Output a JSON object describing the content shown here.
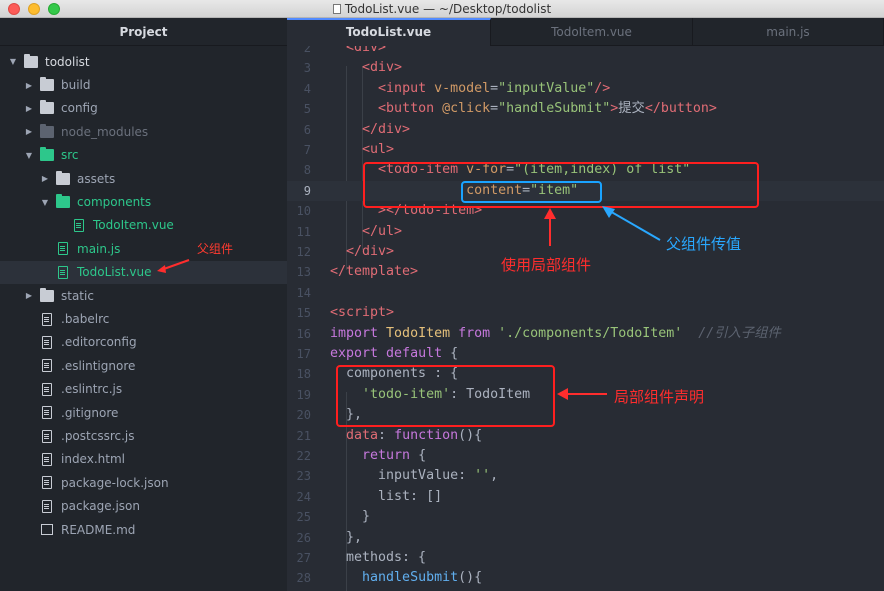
{
  "window": {
    "title": "TodoList.vue — ~/Desktop/todolist"
  },
  "sidebar": {
    "header": "Project",
    "items": [
      {
        "label": "todolist",
        "type": "folder",
        "arrow": "down",
        "depth": 0,
        "style": ""
      },
      {
        "label": "build",
        "type": "folder",
        "arrow": "right",
        "depth": 1,
        "style": ""
      },
      {
        "label": "config",
        "type": "folder",
        "arrow": "right",
        "depth": 1,
        "style": ""
      },
      {
        "label": "node_modules",
        "type": "folder",
        "arrow": "right",
        "depth": 1,
        "style": "dim"
      },
      {
        "label": "src",
        "type": "folder",
        "arrow": "down",
        "depth": 1,
        "style": "green"
      },
      {
        "label": "assets",
        "type": "folder",
        "arrow": "right",
        "depth": 2,
        "style": ""
      },
      {
        "label": "components",
        "type": "folder",
        "arrow": "down",
        "depth": 2,
        "style": "green"
      },
      {
        "label": "TodoItem.vue",
        "type": "file",
        "arrow": "",
        "depth": 3,
        "style": "green"
      },
      {
        "label": "main.js",
        "type": "file",
        "arrow": "",
        "depth": 2,
        "style": "green"
      },
      {
        "label": "TodoList.vue",
        "type": "file",
        "arrow": "",
        "depth": 2,
        "style": "green",
        "selected": true
      },
      {
        "label": "static",
        "type": "folder",
        "arrow": "right",
        "depth": 1,
        "style": ""
      },
      {
        "label": ".babelrc",
        "type": "file",
        "arrow": "",
        "depth": 1,
        "style": ""
      },
      {
        "label": ".editorconfig",
        "type": "file",
        "arrow": "",
        "depth": 1,
        "style": ""
      },
      {
        "label": ".eslintignore",
        "type": "file",
        "arrow": "",
        "depth": 1,
        "style": ""
      },
      {
        "label": ".eslintrc.js",
        "type": "file",
        "arrow": "",
        "depth": 1,
        "style": ""
      },
      {
        "label": ".gitignore",
        "type": "file",
        "arrow": "",
        "depth": 1,
        "style": ""
      },
      {
        "label": ".postcssrc.js",
        "type": "file",
        "arrow": "",
        "depth": 1,
        "style": ""
      },
      {
        "label": "index.html",
        "type": "file",
        "arrow": "",
        "depth": 1,
        "style": ""
      },
      {
        "label": "package-lock.json",
        "type": "file",
        "arrow": "",
        "depth": 1,
        "style": ""
      },
      {
        "label": "package.json",
        "type": "file",
        "arrow": "",
        "depth": 1,
        "style": ""
      },
      {
        "label": "README.md",
        "type": "book",
        "arrow": "",
        "depth": 1,
        "style": ""
      }
    ]
  },
  "tabs": [
    {
      "label": "TodoList.vue",
      "active": true
    },
    {
      "label": "TodoItem.vue",
      "active": false
    },
    {
      "label": "main.js",
      "active": false
    }
  ],
  "editor": {
    "current_line": 9,
    "lines": [
      {
        "n": "2",
        "t": [
          [
            "  ",
            "pun"
          ],
          [
            "<div>",
            "tag"
          ]
        ]
      },
      {
        "n": "3",
        "t": [
          [
            "    ",
            "pun"
          ],
          [
            "<div>",
            "tag"
          ]
        ]
      },
      {
        "n": "4",
        "t": [
          [
            "      ",
            "pun"
          ],
          [
            "<input ",
            "tag"
          ],
          [
            "v-model",
            "attr"
          ],
          [
            "=",
            "pun"
          ],
          [
            "\"inputValue\"",
            "str"
          ],
          [
            "/>",
            "tag"
          ]
        ]
      },
      {
        "n": "5",
        "t": [
          [
            "      ",
            "pun"
          ],
          [
            "<button ",
            "tag"
          ],
          [
            "@click",
            "attr"
          ],
          [
            "=",
            "pun"
          ],
          [
            "\"handleSubmit\"",
            "str"
          ],
          [
            ">",
            "tag"
          ],
          [
            "提交",
            "pun"
          ],
          [
            "</button>",
            "tag"
          ]
        ]
      },
      {
        "n": "6",
        "t": [
          [
            "    ",
            "pun"
          ],
          [
            "</div>",
            "tag"
          ]
        ]
      },
      {
        "n": "7",
        "t": [
          [
            "    ",
            "pun"
          ],
          [
            "<ul>",
            "tag"
          ]
        ]
      },
      {
        "n": "8",
        "t": [
          [
            "      ",
            "pun"
          ],
          [
            "<todo-item ",
            "tag"
          ],
          [
            "v-for",
            "attr"
          ],
          [
            "=",
            "pun"
          ],
          [
            "\"(item,index) of list\"",
            "str"
          ]
        ]
      },
      {
        "n": "9",
        "t": [
          [
            "                ",
            "pun"
          ],
          [
            ":content",
            "attr"
          ],
          [
            "=",
            "pun"
          ],
          [
            "\"item\"",
            "str"
          ]
        ]
      },
      {
        "n": "10",
        "t": [
          [
            "      ",
            "pun"
          ],
          [
            "></todo-item>",
            "tag"
          ]
        ]
      },
      {
        "n": "11",
        "t": [
          [
            "    ",
            "pun"
          ],
          [
            "</ul>",
            "tag"
          ]
        ]
      },
      {
        "n": "12",
        "t": [
          [
            "  ",
            "pun"
          ],
          [
            "</div>",
            "tag"
          ]
        ]
      },
      {
        "n": "13",
        "t": [
          [
            "</template>",
            "tag"
          ]
        ]
      },
      {
        "n": "14",
        "t": []
      },
      {
        "n": "15",
        "t": [
          [
            "<script>",
            "tag"
          ]
        ]
      },
      {
        "n": "16",
        "t": [
          [
            "import ",
            "kw"
          ],
          [
            "TodoItem ",
            "cls"
          ],
          [
            "from ",
            "kw"
          ],
          [
            "'./components/TodoItem'",
            "str"
          ],
          [
            "  //引入子组件",
            "cmt"
          ]
        ]
      },
      {
        "n": "17",
        "t": [
          [
            "export ",
            "kw"
          ],
          [
            "default ",
            "kw"
          ],
          [
            "{",
            "pun"
          ]
        ]
      },
      {
        "n": "18",
        "t": [
          [
            "  components ",
            "pun"
          ],
          [
            ": {",
            "pun"
          ]
        ]
      },
      {
        "n": "19",
        "t": [
          [
            "    ",
            "pun"
          ],
          [
            "'todo-item'",
            "str"
          ],
          [
            ": TodoItem",
            "pun"
          ]
        ]
      },
      {
        "n": "20",
        "t": [
          [
            "  },",
            "pun"
          ]
        ]
      },
      {
        "n": "21",
        "t": [
          [
            "  ",
            "pun"
          ],
          [
            "data",
            "prop"
          ],
          [
            ": ",
            "pun"
          ],
          [
            "function",
            "kw"
          ],
          [
            "(){",
            "pun"
          ]
        ]
      },
      {
        "n": "22",
        "t": [
          [
            "    ",
            "pun"
          ],
          [
            "return ",
            "kw"
          ],
          [
            "{",
            "pun"
          ]
        ]
      },
      {
        "n": "23",
        "t": [
          [
            "      inputValue: ",
            "pun"
          ],
          [
            "''",
            "str"
          ],
          [
            ",",
            "pun"
          ]
        ]
      },
      {
        "n": "24",
        "t": [
          [
            "      list: []",
            "pun"
          ]
        ]
      },
      {
        "n": "25",
        "t": [
          [
            "    }",
            "pun"
          ]
        ]
      },
      {
        "n": "26",
        "t": [
          [
            "  },",
            "pun"
          ]
        ]
      },
      {
        "n": "27",
        "t": [
          [
            "  methods: {",
            "pun"
          ]
        ]
      },
      {
        "n": "28",
        "t": [
          [
            "    ",
            "pun"
          ],
          [
            "handleSubmit",
            "fn"
          ],
          [
            "(){",
            "pun"
          ]
        ]
      }
    ]
  },
  "annotations": {
    "parent_component": "父组件",
    "use_local_component": "使用局部组件",
    "pass_value": "父组件传值",
    "local_declaration": "局部组件声明"
  },
  "colors": {
    "annotation_red": "#ff1f1f",
    "annotation_blue": "#1aa3ff",
    "tree_green": "#2dc78b"
  }
}
